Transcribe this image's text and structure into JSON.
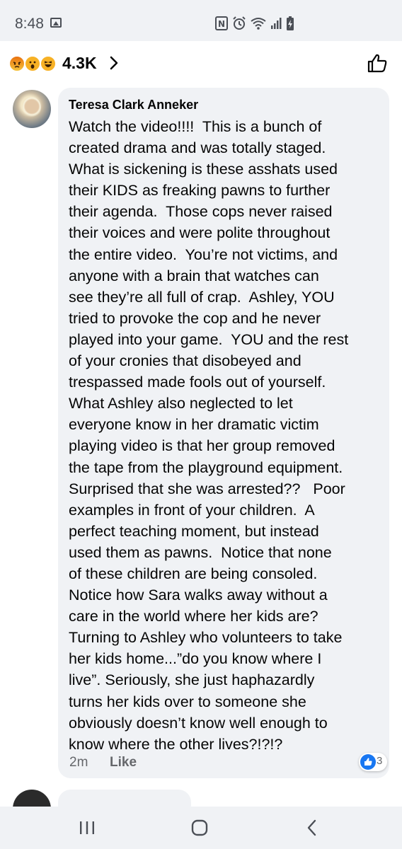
{
  "status_bar": {
    "time": "8:48",
    "icons": [
      "gallery-icon",
      "nfc-icon",
      "alarm-icon",
      "wifi-icon",
      "signal-icon",
      "battery-charging-icon"
    ]
  },
  "reactions": {
    "emoji_names": [
      "angry-emoji",
      "wow-emoji",
      "haha-emoji"
    ],
    "count": "4.3K"
  },
  "comment": {
    "author": "Teresa Clark Anneker",
    "lines": [
      "Watch the video!!!!  This is a bunch of",
      "created drama and was totally staged.",
      "What is sickening is these asshats used",
      "their KIDS as freaking pawns to further",
      "their agenda.  Those cops never raised",
      "their voices and were polite throughout",
      "the entire video.  You’re not victims, and",
      "anyone with a brain that watches can",
      "see they’re all full of crap.  Ashley, YOU",
      "tried to provoke the cop and he never",
      "played into your game.  YOU and the rest",
      "of your cronies that disobeyed and",
      "trespassed made fools out of yourself.",
      "What Ashley also neglected to let",
      "everyone know in her dramatic victim",
      "playing video is that her group removed",
      "the tape from the playground equipment.",
      "Surprised that she was arrested??   Poor",
      "examples in front of your children.  A",
      "perfect teaching moment, but instead",
      "used them as pawns.  Notice that none",
      "of these children are being consoled.",
      "Notice how Sara walks away without a",
      "care in the world where her kids are?",
      "Turning to Ashley who volunteers to take",
      "her kids home...”do you know where I",
      "live”. Seriously, she just haphazardly",
      "turns her kids over to someone she",
      "obviously doesn’t know well enough to",
      "know where the other lives?!?!?"
    ],
    "timestamp": "2m",
    "like_label": "Like",
    "reaction_count": "3",
    "colors": {
      "like_blue": "#1877f2",
      "bubble": "#f0f2f5",
      "meta": "#65676b"
    }
  },
  "nav": {
    "icons": [
      "recent-apps-icon",
      "home-icon",
      "back-icon"
    ]
  }
}
